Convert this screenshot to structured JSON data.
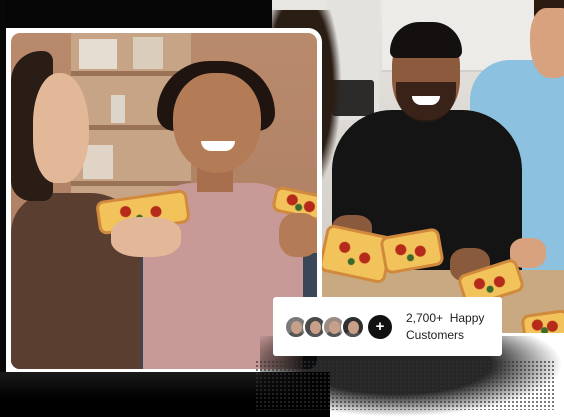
{
  "badge": {
    "count": "2,700+",
    "label_word1": "Happy",
    "label_word2": "Customers",
    "plus_symbol": "+",
    "avatars": [
      "customer-avatar-1",
      "customer-avatar-2",
      "customer-avatar-3",
      "customer-avatar-4"
    ]
  },
  "images": {
    "left": "friends-eating-pizza-photo",
    "right": "group-sharing-pizza-photo"
  },
  "colors": {
    "badge_background": "#ffffff",
    "plus_avatar": "#111111",
    "text": "#1e1e1e"
  }
}
